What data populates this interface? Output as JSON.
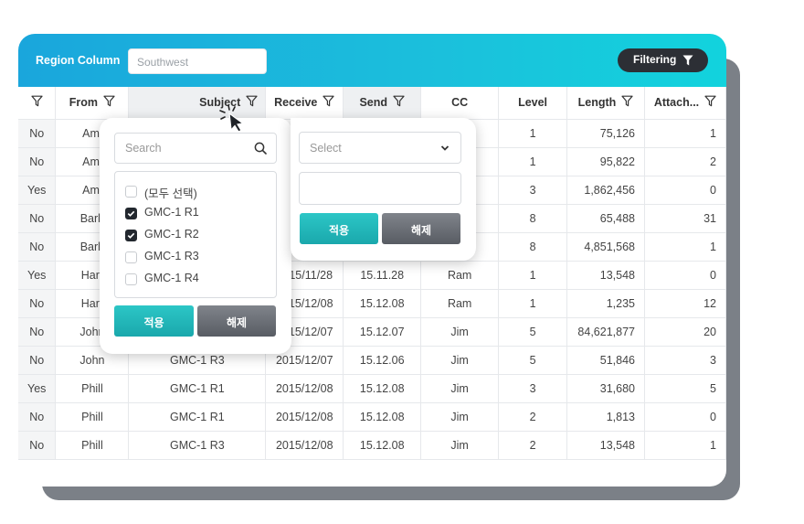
{
  "header": {
    "region_label": "Region Column",
    "region_placeholder": "Southwest",
    "filter_button_label": "Filtering"
  },
  "colors": {
    "header_gradient_start": "#1aa6dc",
    "header_gradient_end": "#12d3dd",
    "apply_button": "#22b8bb",
    "clear_button": "#6c7077",
    "filter_button": "#2c2f35",
    "shadow_card": "#7b8087"
  },
  "table": {
    "columns": [
      "",
      "From",
      "Subject",
      "Receive",
      "Send",
      "CC",
      "Level",
      "Length",
      "Attach..."
    ],
    "rows": [
      [
        "No",
        "Ami",
        "",
        "",
        "",
        "",
        "1",
        "75,126",
        "1"
      ],
      [
        "No",
        "Ami",
        "",
        "",
        "",
        "",
        "1",
        "95,822",
        "2"
      ],
      [
        "Yes",
        "Ami",
        "",
        "",
        "",
        "",
        "3",
        "1,862,456",
        "0"
      ],
      [
        "No",
        "Barb",
        "",
        "",
        "",
        "",
        "8",
        "65,488",
        "31"
      ],
      [
        "No",
        "Barb",
        "",
        "",
        "",
        "",
        "8",
        "4,851,568",
        "1"
      ],
      [
        "Yes",
        "Harr",
        "",
        "2015/11/28",
        "15.11.28",
        "Ram",
        "1",
        "13,548",
        "0"
      ],
      [
        "No",
        "Harr",
        "",
        "2015/12/08",
        "15.12.08",
        "Ram",
        "1",
        "1,235",
        "12"
      ],
      [
        "No",
        "John",
        "",
        "2015/12/07",
        "15.12.07",
        "Jim",
        "5",
        "84,621,877",
        "20"
      ],
      [
        "No",
        "John",
        "GMC-1 R3",
        "2015/12/07",
        "15.12.06",
        "Jim",
        "5",
        "51,846",
        "3"
      ],
      [
        "Yes",
        "Phill",
        "GMC-1 R1",
        "2015/12/08",
        "15.12.08",
        "Jim",
        "3",
        "31,680",
        "5"
      ],
      [
        "No",
        "Phill",
        "GMC-1 R1",
        "2015/12/08",
        "15.12.08",
        "Jim",
        "2",
        "1,813",
        "0"
      ],
      [
        "No",
        "Phill",
        "GMC-1 R3",
        "2015/12/08",
        "15.12.08",
        "Jim",
        "2",
        "13,548",
        "1"
      ]
    ]
  },
  "subject_filter": {
    "search_placeholder": "Search",
    "items": [
      {
        "label": "(모두 선택)",
        "checked": false
      },
      {
        "label": "GMC-1 R1",
        "checked": true
      },
      {
        "label": "GMC-1 R2",
        "checked": true
      },
      {
        "label": "GMC-1 R3",
        "checked": false
      },
      {
        "label": "GMC-1 R4",
        "checked": false
      }
    ],
    "apply_label": "적용",
    "clear_label": "해제"
  },
  "condition_filter": {
    "select_placeholder": "Select",
    "value": "",
    "apply_label": "적용",
    "clear_label": "해제"
  },
  "icons": {
    "column_filter": "funnel-outline-icon",
    "filter_button": "funnel-filled-icon",
    "search": "search-icon",
    "dropdown": "chevron-down-icon",
    "cursor": "click-pointer-icon"
  }
}
